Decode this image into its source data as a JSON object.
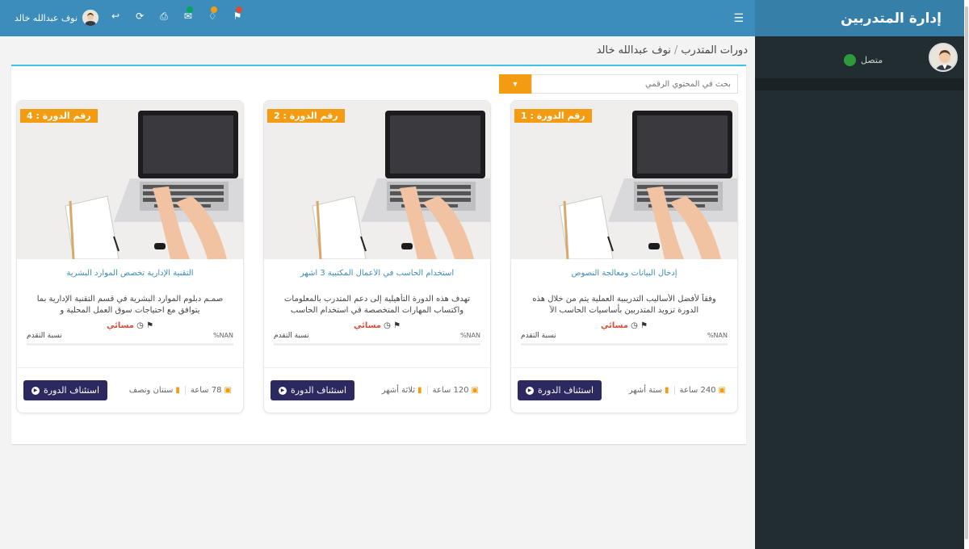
{
  "sidebar": {
    "brand": "إدارة المتدربين",
    "status_label": "متصل",
    "status_color": "#2e9a3b"
  },
  "navbar": {
    "toggle_icon": "hamburger-icon",
    "user_name": "نوف عبدالله خالد",
    "icons": [
      "messages-icon",
      "notifications-icon",
      "mail-icon",
      "print-icon",
      "refresh-icon",
      "back-icon"
    ],
    "bg_color": "#3c8dbc"
  },
  "breadcrumb": {
    "section": "دورات المتدرب",
    "current": "نوف عبدالله خالد"
  },
  "search": {
    "placeholder": "بحث في المحتوي الرقمي",
    "button_icon": "filter-icon",
    "accent": "#f39c12"
  },
  "cards": [
    {
      "number": "رقم الدورة : 1",
      "title": "إدخال البيانات ومعالجة النصوص",
      "desc": "وفقاً لأفضل الأساليب التدريبية العملية يتم من خلال هذه الدورة تزويد المتدربين بأساسيات الحاسب الآ",
      "period": "مسائي",
      "progress_pct": "%NAN",
      "progress_label": "نسبة التقدم",
      "hours": "240 ساعة",
      "duration": "ستة أشهر",
      "button": "استئناف الدورة"
    },
    {
      "number": "رقم الدورة : 2",
      "title": "استخدام الحاسب في الأعمال المكتبية 3 اشهر",
      "desc": "تهدف هذه الدورة التأهيلية إلى دعم المتدرب بالمعلومات واكتساب المهارات المتخصصة في استخدام الحاسب",
      "period": "مسائي",
      "progress_pct": "%NAN",
      "progress_label": "نسبة التقدم",
      "hours": "120 ساعة",
      "duration": "ثلاثة أشهر",
      "button": "استئناف الدورة"
    },
    {
      "number": "رقم الدورة : 4",
      "title": "التقنية الإدارية تخصص الموارد البشرية",
      "desc": "صمـم دبلوم الموارد البشرية في قسم التقنية الإدارية بما يتوافق مع احتياجات سوق العمل المحلية و",
      "period": "مسائي",
      "progress_pct": "%NAN",
      "progress_label": "نسبة التقدم",
      "hours": "78 ساعة",
      "duration": "سنتان ونصف",
      "button": "استئناف الدورة"
    }
  ]
}
